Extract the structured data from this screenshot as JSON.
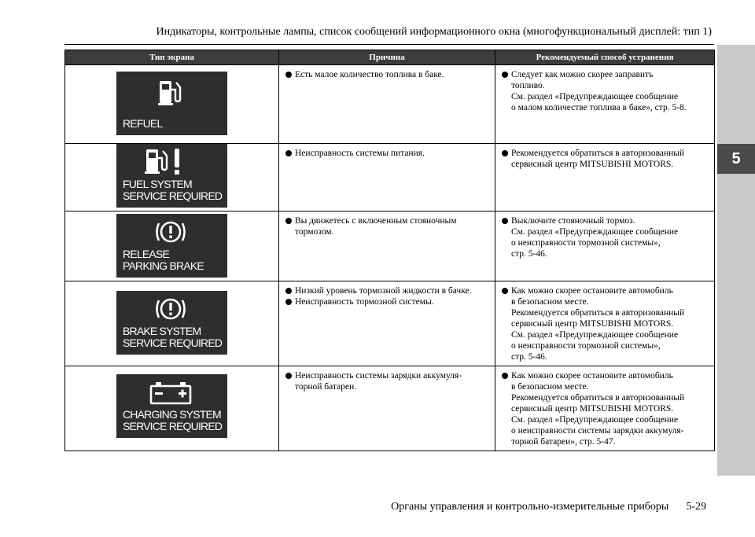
{
  "header": {
    "title": "Индикаторы, контрольные лампы, список сообщений информационного окна (многофункциональный дисплей: тип 1)"
  },
  "side_tab": {
    "chapter": "5"
  },
  "table": {
    "columns": [
      "Тип экрана",
      "Причина",
      "Рекомендуемый способ устранения"
    ],
    "rows": [
      {
        "screen_lines": [
          "REFUEL"
        ],
        "icon": "fuel-pump-icon",
        "cause": [
          "Есть малое количество топлива в баке."
        ],
        "remedy": [
          {
            "first": "Следует как можно скорее заправить",
            "more": [
              "топливо.",
              "См. раздел «Предупреждающее сообщение",
              "о малом количестве топлива в баке», стр. 5-8."
            ]
          }
        ]
      },
      {
        "screen_lines": [
          "FUEL SYSTEM",
          "SERVICE REQUIRED"
        ],
        "icon": "fuel-pump-exclamation-icon",
        "cause": [
          "Неисправность системы питания."
        ],
        "remedy": [
          {
            "first": "Рекомендуется обратиться в авторизованный",
            "more": [
              "сервисный центр MITSUBISHI MOTORS."
            ]
          }
        ]
      },
      {
        "screen_lines": [
          "RELEASE",
          "PARKING BRAKE"
        ],
        "icon": "brake-warning-icon",
        "cause": [
          {
            "first": "Вы движетесь с включенным стояночным",
            "more": [
              "тормозом."
            ]
          }
        ],
        "remedy": [
          {
            "first": "Выключите стояночный тормоз.",
            "more": [
              "См. раздел «Предупреждающее сообщение",
              "о неисправности тормозной системы»,",
              "стр. 5-46."
            ]
          }
        ]
      },
      {
        "screen_lines": [
          "BRAKE SYSTEM",
          "SERVICE REQUIRED"
        ],
        "icon": "brake-warning-icon",
        "cause": [
          "Низкий уровень тормозной жидкости в бачке.",
          "Неисправность тормозной системы."
        ],
        "remedy": [
          {
            "first": "Как можно скорее остановите автомобиль",
            "more": [
              "в безопасном месте.",
              "Рекомендуется обратиться в авторизованный",
              "сервисный центр MITSUBISHI MOTORS.",
              "См. раздел «Предупреждающее сообщение",
              "о неисправности тормозной системы»,",
              "стр. 5-46."
            ]
          }
        ]
      },
      {
        "screen_lines": [
          "CHARGING SYSTEM",
          "SERVICE REQUIRED"
        ],
        "icon": "battery-icon",
        "cause": [
          {
            "first": "Неисправность системы зарядки аккумуля-",
            "more": [
              "торной батареи."
            ]
          }
        ],
        "remedy": [
          {
            "first": "Как можно скорее остановите автомобиль",
            "more": [
              "в безопасном месте.",
              "Рекомендуется обратиться в авторизованный",
              "сервисный центр MITSUBISHI MOTORS.",
              "См. раздел «Предупреждающее сообщение",
              "о неисправности системы зарядки аккумуля-",
              "торной батареи», стр. 5-47."
            ]
          }
        ]
      }
    ]
  },
  "footer": {
    "section": "Органы управления и контрольно-измерительные приборы",
    "page": "5-29"
  }
}
